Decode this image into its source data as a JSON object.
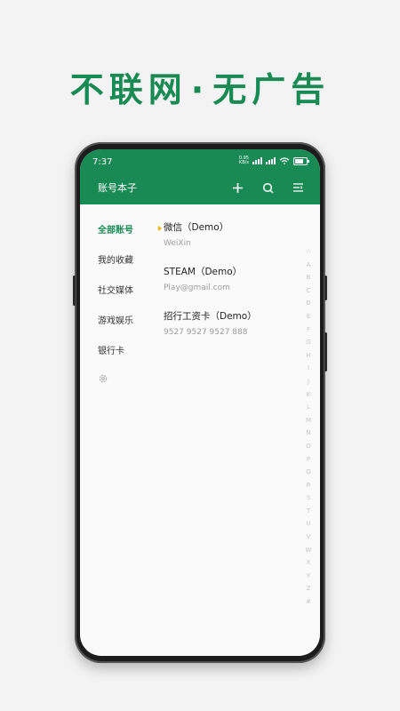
{
  "headline": {
    "part1": "不联网",
    "dot": "·",
    "part2": "无广告"
  },
  "status": {
    "time": "7:37",
    "speed_value": "0.95",
    "speed_unit": "KB/s"
  },
  "appbar": {
    "title": "账号本子",
    "icons": [
      "plus-icon",
      "search-icon",
      "filter-icon"
    ]
  },
  "sidebar": {
    "items": [
      {
        "label": "全部账号",
        "active": true
      },
      {
        "label": "我的收藏",
        "active": false
      },
      {
        "label": "社交媒体",
        "active": false
      },
      {
        "label": "游戏娱乐",
        "active": false
      },
      {
        "label": "银行卡",
        "active": false
      }
    ],
    "settings_icon": "gear-icon"
  },
  "accounts": [
    {
      "name": "微信（Demo）",
      "sub": "WeiXin"
    },
    {
      "name": "STEAM（Demo）",
      "sub": "Play@gmail.com"
    },
    {
      "name": "招行工资卡（Demo）",
      "sub": "9527 9527 9527 888"
    }
  ],
  "alphabet": [
    "☆",
    "A",
    "B",
    "C",
    "D",
    "E",
    "F",
    "G",
    "H",
    "I",
    "J",
    "K",
    "L",
    "M",
    "N",
    "O",
    "P",
    "Q",
    "R",
    "S",
    "T",
    "U",
    "V",
    "W",
    "X",
    "Y",
    "Z",
    "#"
  ],
  "colors": {
    "accent": "#1a8a55",
    "marker": "#f2b400"
  }
}
